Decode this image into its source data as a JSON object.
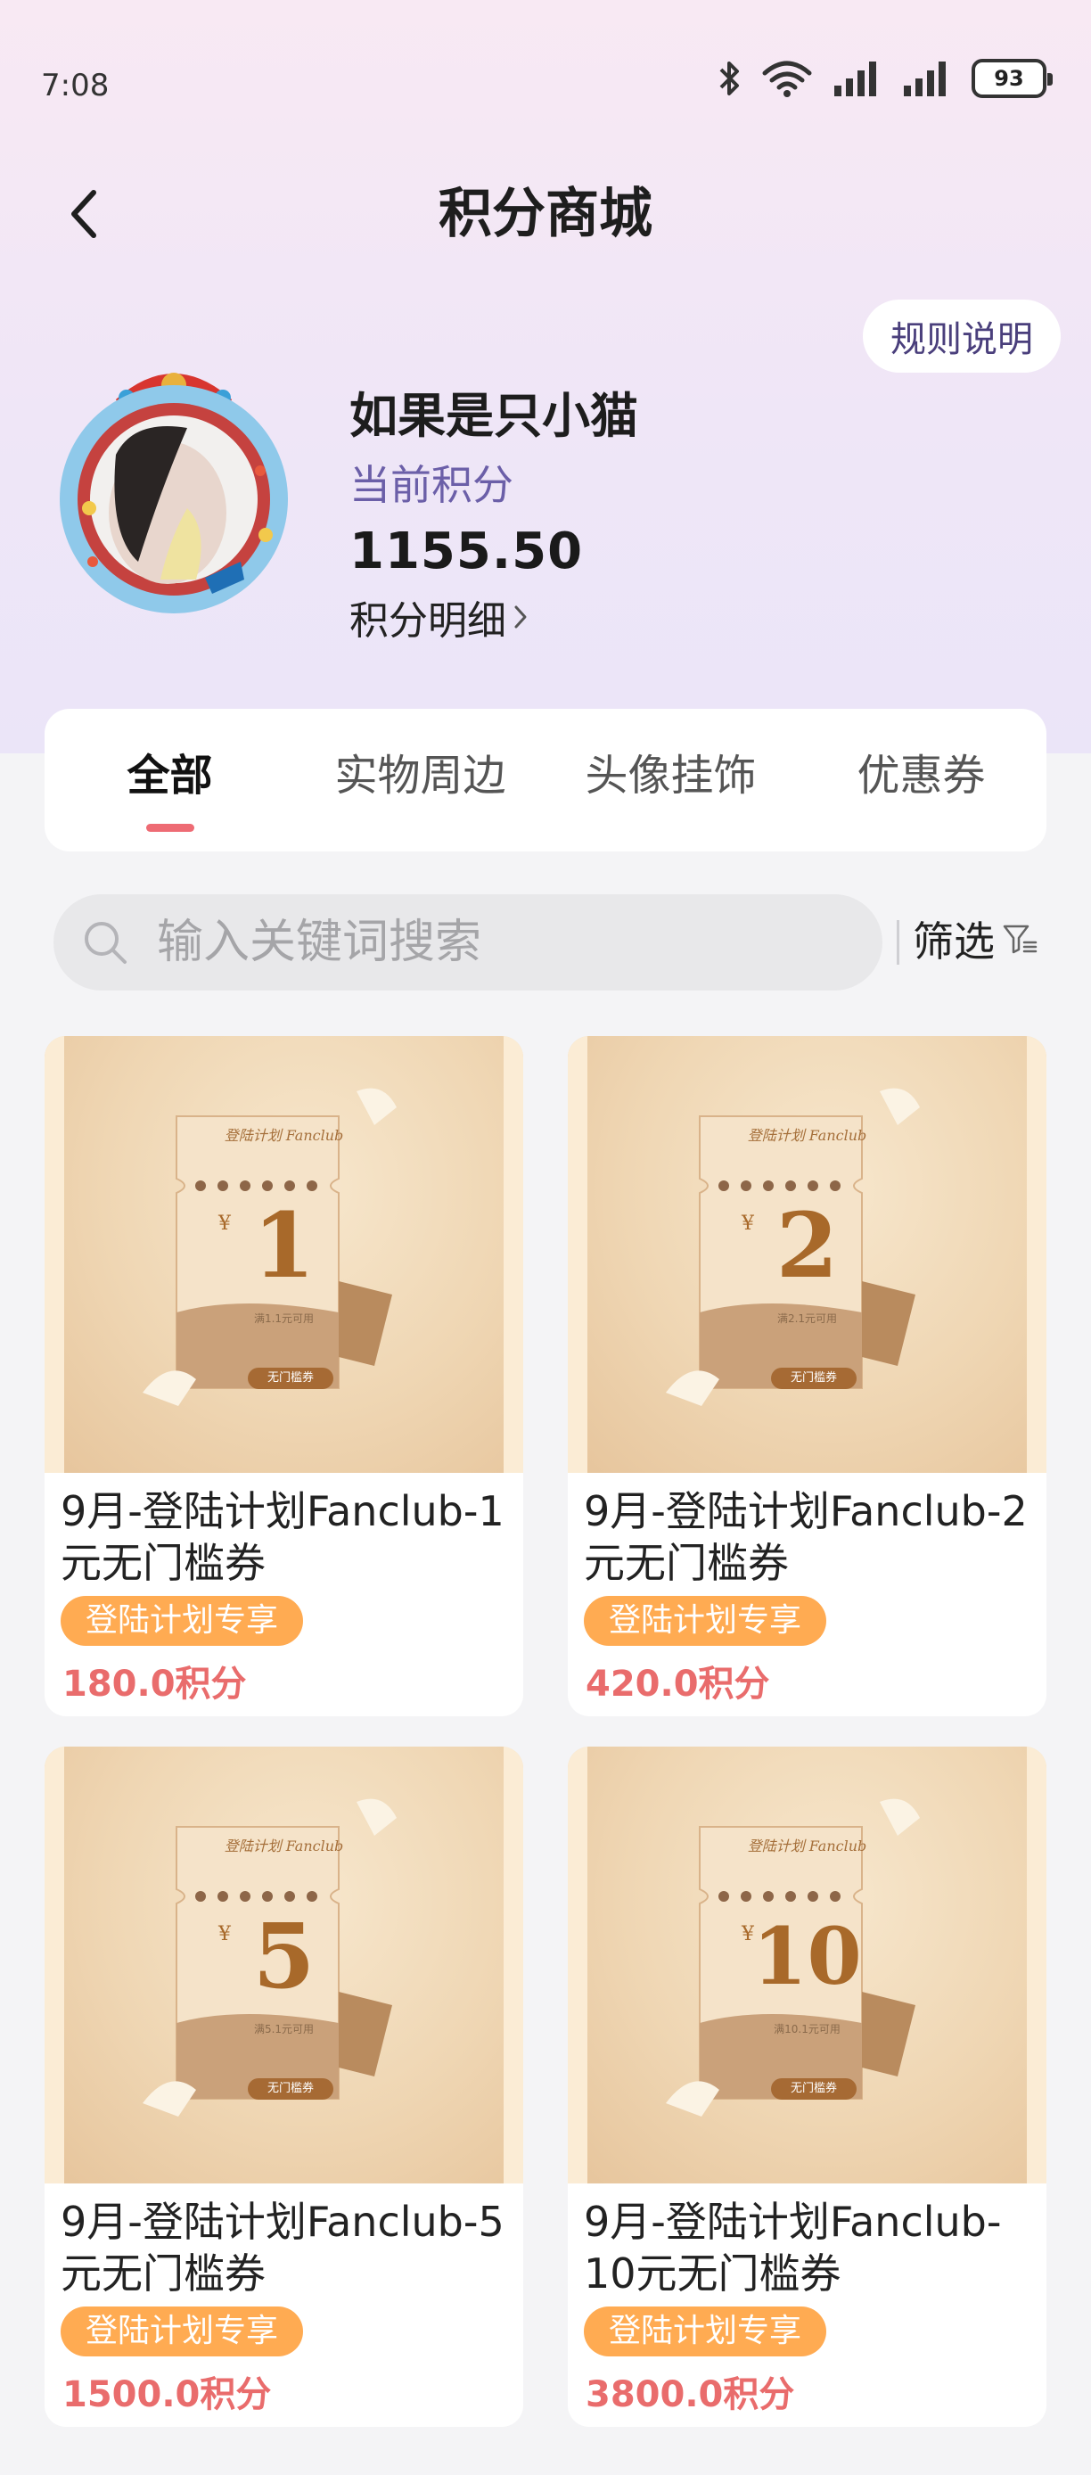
{
  "status_bar": {
    "time": "7:08",
    "battery": "93"
  },
  "header": {
    "title": "积分商城",
    "rules_label": "规则说明"
  },
  "profile": {
    "username": "如果是只小猫",
    "points_label": "当前积分",
    "points_value": "1155.50",
    "detail_label": "积分明细"
  },
  "tabs": [
    {
      "label": "全部",
      "active": true
    },
    {
      "label": "实物周边",
      "active": false
    },
    {
      "label": "头像挂饰",
      "active": false
    },
    {
      "label": "优惠券",
      "active": false
    }
  ],
  "search": {
    "placeholder": "输入关键词搜索",
    "filter_label": "筛选"
  },
  "products": [
    {
      "title": "9月-登陆计划Fanclub-1元无门槛券",
      "badge": "登陆计划专享",
      "price": "180.0积分",
      "ticket_head": "登陆计划 Fanclub",
      "ticket_amount": "1",
      "ticket_condition": "满1.1元可用",
      "ticket_tag": "无门槛券"
    },
    {
      "title": "9月-登陆计划Fanclub-2元无门槛券",
      "badge": "登陆计划专享",
      "price": "420.0积分",
      "ticket_head": "登陆计划 Fanclub",
      "ticket_amount": "2",
      "ticket_condition": "满2.1元可用",
      "ticket_tag": "无门槛券"
    },
    {
      "title": "9月-登陆计划Fanclub-5元无门槛券",
      "badge": "登陆计划专享",
      "price": "1500.0积分",
      "ticket_head": "登陆计划 Fanclub",
      "ticket_amount": "5",
      "ticket_condition": "满5.1元可用",
      "ticket_tag": "无门槛券"
    },
    {
      "title": "9月-登陆计划Fanclub-10元无门槛券",
      "badge": "登陆计划专享",
      "price": "3800.0积分",
      "ticket_head": "登陆计划 Fanclub",
      "ticket_amount": "10",
      "ticket_condition": "满10.1元可用",
      "ticket_tag": "无门槛券"
    }
  ],
  "colors": {
    "accent_tab": "#ee6b74",
    "badge": "#ffab52",
    "price": "#e96c6c",
    "points_label": "#6b5fa8"
  },
  "icons": {
    "back": "chevron-left-icon",
    "detail": "chevron-right-icon",
    "search": "search-icon",
    "filter": "filter-icon"
  }
}
